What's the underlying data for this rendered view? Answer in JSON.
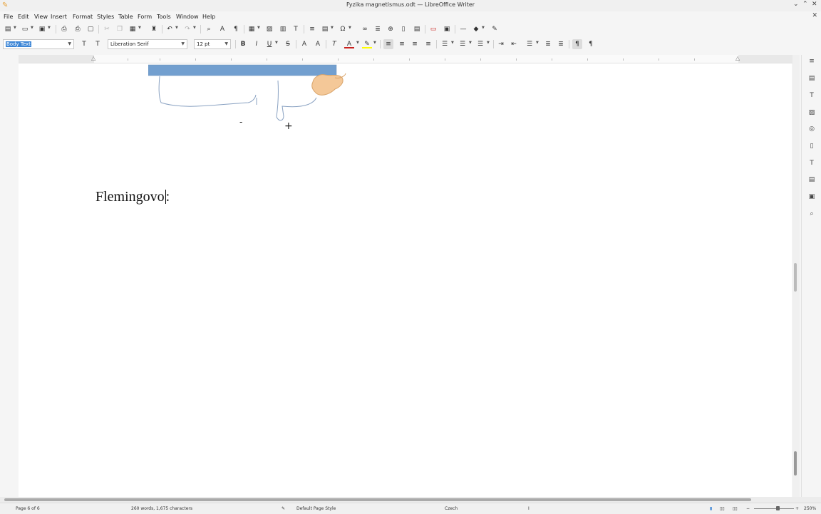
{
  "window": {
    "title": "Fyzika magnetismus.odt — LibreOffice Writer",
    "app_icon": "writer-icon"
  },
  "menu": [
    "File",
    "Edit",
    "View",
    "Insert",
    "Format",
    "Styles",
    "Table",
    "Form",
    "Tools",
    "Window",
    "Help"
  ],
  "formatting": {
    "paragraph_style": "Body Text",
    "font_name": "Liberation Serif",
    "font_size": "12 pt"
  },
  "document": {
    "heading_text": "Flemingovo",
    "heading_suffix": ":",
    "drawing": {
      "minus_label": "-",
      "plus_label": "+",
      "bar_color": "#729fcf",
      "hand_color": "#f4c898"
    }
  },
  "status": {
    "page": "Page 6 of 6",
    "words": "260 words, 1,675 characters",
    "page_style": "Default Page Style",
    "language": "Czech",
    "zoom": "250%"
  },
  "colors": {
    "accent": "#3d86d6",
    "font_color_bar": "#c9211e",
    "highlight_bar": "#ffff00"
  }
}
